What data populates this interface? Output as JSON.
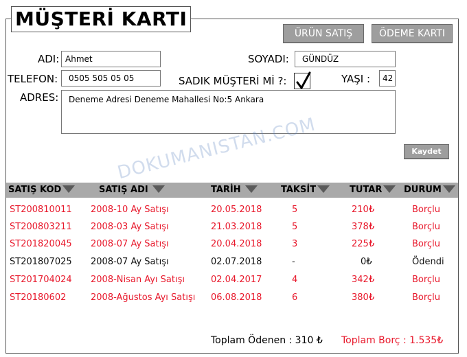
{
  "title": "MÜŞTERİ KARTI",
  "buttons": {
    "urun_satis": "ÜRÜN SATIŞ",
    "odeme_karti": "ÖDEME KARTI",
    "kaydet": "Kaydet"
  },
  "form": {
    "adi_label": "ADI:",
    "adi_value": "Ahmet",
    "soyadi_label": "SOYADI:",
    "soyadi_value": "GÜNDÜZ",
    "telefon_label": "TELEFON:",
    "telefon_value": "0505 505 05 05",
    "sadik_label": "SADIK MÜŞTERİ Mİ ?:",
    "sadik_checked": true,
    "yasi_label": "YAŞI :",
    "yasi_value": "42",
    "adres_label": "ADRES:",
    "adres_value": "Deneme Adresi Deneme Mahallesi No:5 Ankara"
  },
  "watermark": "DOKUMANISTAN.COM",
  "table": {
    "columns": [
      "SATIŞ KOD",
      "SATIŞ ADI",
      "TARİH",
      "TAKSİT",
      "TUTAR",
      "DURUM"
    ],
    "rows": [
      {
        "kod": "ST200810011",
        "adi": "2008-10 Ay Satışı",
        "tarih": "20.05.2018",
        "taksit": "5",
        "tutar": "210₺",
        "durum": "Borçlu",
        "status": "debt"
      },
      {
        "kod": "ST200803211",
        "adi": "2008-03 Ay Satışı",
        "tarih": "21.03.2018",
        "taksit": "5",
        "tutar": "378₺",
        "durum": "Borçlu",
        "status": "debt"
      },
      {
        "kod": "ST201820045",
        "adi": "2008-07 Ay Satışı",
        "tarih": "20.04.2018",
        "taksit": "3",
        "tutar": "225₺",
        "durum": "Borçlu",
        "status": "debt"
      },
      {
        "kod": "ST201807025",
        "adi": "2008-07 Ay Satışı",
        "tarih": "02.07.2018",
        "taksit": "-",
        "tutar": "0₺",
        "durum": "Ödendi",
        "status": "paid"
      },
      {
        "kod": "ST201704024",
        "adi": "2008-Nisan Ayı Satışı",
        "tarih": "02.04.2017",
        "taksit": "4",
        "tutar": "342₺",
        "durum": "Borçlu",
        "status": "debt"
      },
      {
        "kod": "ST20180602",
        "adi": "2008-Ağustos Ayı Satışı",
        "tarih": "06.08.2018",
        "taksit": "6",
        "tutar": "380₺",
        "durum": "Borçlu",
        "status": "debt"
      }
    ]
  },
  "totals": {
    "odenen": "Toplam Ödenen : 310 ₺",
    "borc": "Toplam Borç : 1.535₺"
  },
  "colors": {
    "debt": "#e8192c",
    "paid": "#111111",
    "header_bg": "#a9a9a9",
    "button_bg": "#9e9e9e"
  },
  "icons": {
    "sort": "sort-down-triangle-icon",
    "check": "checkmark-icon"
  }
}
